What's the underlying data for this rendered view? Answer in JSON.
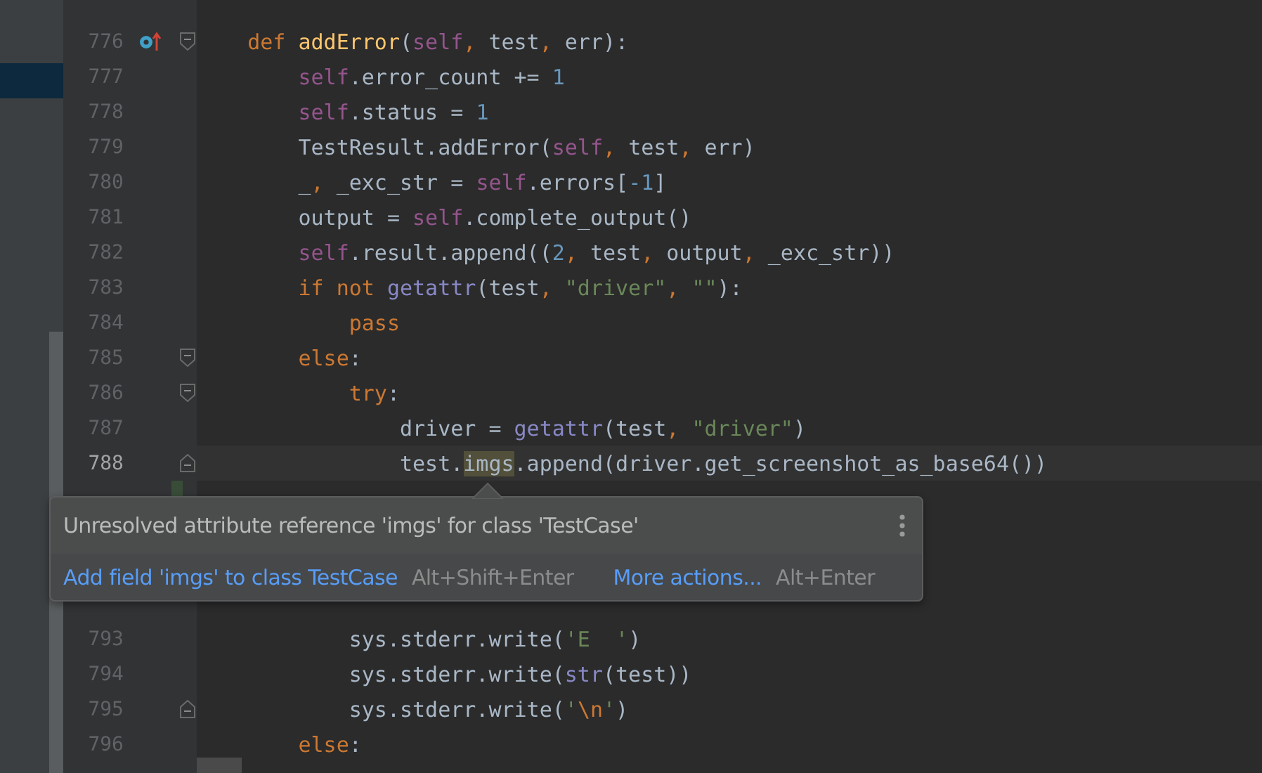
{
  "editor": {
    "lines_above": [
      {
        "number": "776",
        "current": false,
        "fold_marker": {
          "kind": "start"
        },
        "gutter_icon": {
          "kind": "override"
        },
        "tokens": [
          {
            "kind": "keyword",
            "text": "    def "
          },
          {
            "kind": "function",
            "text": "addError"
          },
          {
            "kind": "plain",
            "text": "("
          },
          {
            "kind": "self",
            "text": "self"
          },
          {
            "kind": "comma",
            "text": ", "
          },
          {
            "kind": "plain",
            "text": "test"
          },
          {
            "kind": "comma",
            "text": ", "
          },
          {
            "kind": "plain",
            "text": "err):"
          }
        ]
      },
      {
        "number": "777",
        "current": false,
        "tokens": [
          {
            "kind": "self",
            "text": "        self"
          },
          {
            "kind": "plain",
            "text": ".error_count += "
          },
          {
            "kind": "number",
            "text": "1"
          }
        ]
      },
      {
        "number": "778",
        "current": false,
        "tokens": [
          {
            "kind": "self",
            "text": "        self"
          },
          {
            "kind": "plain",
            "text": ".status = "
          },
          {
            "kind": "number",
            "text": "1"
          }
        ]
      },
      {
        "number": "779",
        "current": false,
        "tokens": [
          {
            "kind": "plain",
            "text": "        TestResult.addError("
          },
          {
            "kind": "self",
            "text": "self"
          },
          {
            "kind": "comma",
            "text": ", "
          },
          {
            "kind": "plain",
            "text": "test"
          },
          {
            "kind": "comma",
            "text": ", "
          },
          {
            "kind": "plain",
            "text": "err)"
          }
        ]
      },
      {
        "number": "780",
        "current": false,
        "tokens": [
          {
            "kind": "plain",
            "text": "        _"
          },
          {
            "kind": "comma",
            "text": ", "
          },
          {
            "kind": "plain",
            "text": "_exc_str = "
          },
          {
            "kind": "self",
            "text": "self"
          },
          {
            "kind": "plain",
            "text": ".errors["
          },
          {
            "kind": "number",
            "text": "-1"
          },
          {
            "kind": "plain",
            "text": "]"
          }
        ]
      },
      {
        "number": "781",
        "current": false,
        "tokens": [
          {
            "kind": "plain",
            "text": "        output = "
          },
          {
            "kind": "self",
            "text": "self"
          },
          {
            "kind": "plain",
            "text": ".complete_output()"
          }
        ]
      },
      {
        "number": "782",
        "current": false,
        "tokens": [
          {
            "kind": "self",
            "text": "        self"
          },
          {
            "kind": "plain",
            "text": ".result.append(("
          },
          {
            "kind": "number",
            "text": "2"
          },
          {
            "kind": "comma",
            "text": ", "
          },
          {
            "kind": "plain",
            "text": "test"
          },
          {
            "kind": "comma",
            "text": ", "
          },
          {
            "kind": "plain",
            "text": "output"
          },
          {
            "kind": "comma",
            "text": ", "
          },
          {
            "kind": "plain",
            "text": "_exc_str))"
          }
        ]
      },
      {
        "number": "783",
        "current": false,
        "tokens": [
          {
            "kind": "keyword",
            "text": "        if not "
          },
          {
            "kind": "builtin",
            "text": "getattr"
          },
          {
            "kind": "plain",
            "text": "(test"
          },
          {
            "kind": "comma",
            "text": ", "
          },
          {
            "kind": "string",
            "text": "\"driver\""
          },
          {
            "kind": "comma",
            "text": ", "
          },
          {
            "kind": "string",
            "text": "\"\""
          },
          {
            "kind": "plain",
            "text": "):"
          }
        ]
      },
      {
        "number": "784",
        "current": false,
        "tokens": [
          {
            "kind": "keyword",
            "text": "            pass"
          }
        ]
      },
      {
        "number": "785",
        "current": false,
        "fold_marker": {
          "kind": "start"
        },
        "tokens": [
          {
            "kind": "keyword",
            "text": "        else"
          },
          {
            "kind": "plain",
            "text": ":"
          }
        ]
      },
      {
        "number": "786",
        "current": false,
        "fold_marker": {
          "kind": "start"
        },
        "tokens": [
          {
            "kind": "keyword",
            "text": "            try"
          },
          {
            "kind": "plain",
            "text": ":"
          }
        ]
      },
      {
        "number": "787",
        "current": false,
        "tokens": [
          {
            "kind": "plain",
            "text": "                driver = "
          },
          {
            "kind": "builtin",
            "text": "getattr"
          },
          {
            "kind": "plain",
            "text": "(test"
          },
          {
            "kind": "comma",
            "text": ", "
          },
          {
            "kind": "string",
            "text": "\"driver\""
          },
          {
            "kind": "plain",
            "text": ")"
          }
        ]
      },
      {
        "number": "788",
        "current": true,
        "fold_marker": {
          "kind": "end"
        },
        "tokens": [
          {
            "kind": "plain",
            "text": "                test."
          },
          {
            "kind": "unresolved",
            "text": "imgs"
          },
          {
            "kind": "plain",
            "text": ".append(driver.get_screenshot_as_base64())"
          }
        ]
      }
    ],
    "lines_below": [
      {
        "number": "793",
        "current": false,
        "tokens": [
          {
            "kind": "plain",
            "text": "            sys.stderr.write("
          },
          {
            "kind": "string",
            "text": "'E  '"
          },
          {
            "kind": "plain",
            "text": ")"
          }
        ]
      },
      {
        "number": "794",
        "current": false,
        "tokens": [
          {
            "kind": "plain",
            "text": "            sys.stderr.write("
          },
          {
            "kind": "builtin",
            "text": "str"
          },
          {
            "kind": "plain",
            "text": "(test))"
          }
        ]
      },
      {
        "number": "795",
        "current": false,
        "fold_marker": {
          "kind": "end"
        },
        "tokens": [
          {
            "kind": "plain",
            "text": "            sys.stderr.write("
          },
          {
            "kind": "string",
            "text": "'"
          },
          {
            "kind": "escape",
            "text": "\\n"
          },
          {
            "kind": "string",
            "text": "'"
          },
          {
            "kind": "plain",
            "text": ")"
          }
        ]
      },
      {
        "number": "796",
        "current": false,
        "tokens": [
          {
            "kind": "keyword",
            "text": "        else"
          },
          {
            "kind": "plain",
            "text": ":"
          }
        ]
      }
    ]
  },
  "popup": {
    "message": "Unresolved attribute reference 'imgs' for class 'TestCase'",
    "actions": [
      {
        "label": "Add field 'imgs' to class TestCase",
        "shortcut": "Alt+Shift+Enter"
      },
      {
        "label": "More actions...",
        "shortcut": "Alt+Enter"
      }
    ]
  }
}
